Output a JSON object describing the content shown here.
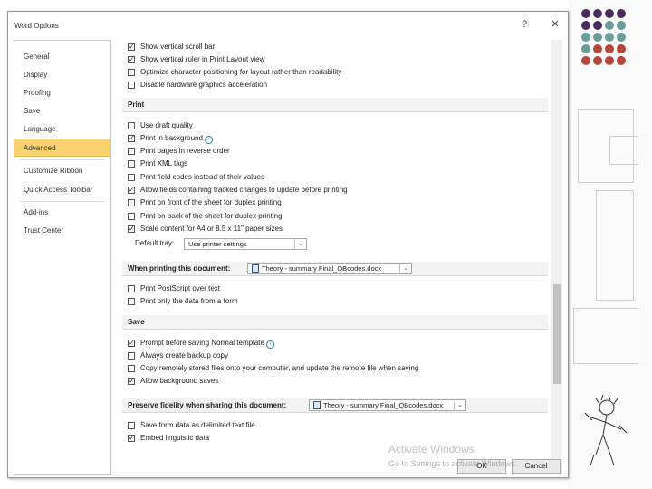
{
  "window": {
    "title": "Word Options",
    "help_label": "?",
    "close_label": "✕"
  },
  "nav": {
    "items": [
      {
        "label": "General"
      },
      {
        "label": "Display"
      },
      {
        "label": "Proofing"
      },
      {
        "label": "Save"
      },
      {
        "label": "Language"
      },
      {
        "label": "Advanced",
        "selected": true
      },
      {
        "label": "Customize Ribbon"
      },
      {
        "label": "Quick Access Toolbar"
      },
      {
        "label": "Add-ins"
      },
      {
        "label": "Trust Center"
      }
    ]
  },
  "display_options": [
    {
      "label": "Show vertical scroll bar",
      "checked": true
    },
    {
      "label": "Show vertical ruler in Print Layout view",
      "checked": true
    },
    {
      "label": "Optimize character positioning for layout rather than readability",
      "checked": false
    },
    {
      "label": "Disable hardware graphics acceleration",
      "checked": false
    }
  ],
  "print": {
    "header": "Print",
    "options": [
      {
        "label": "Use draft quality",
        "checked": false
      },
      {
        "label": "Print in background",
        "checked": true
      },
      {
        "label": "Print pages in reverse order",
        "checked": false
      },
      {
        "label": "Print XML tags",
        "checked": false
      },
      {
        "label": "Print field codes instead of their values",
        "checked": false
      },
      {
        "label": "Allow fields containing tracked changes to update before printing",
        "checked": true
      },
      {
        "label": "Print on front of the sheet for duplex printing",
        "checked": false
      },
      {
        "label": "Print on back of the sheet for duplex printing",
        "checked": false
      },
      {
        "label": "Scale content for A4 or 8.5 x 11\" paper sizes",
        "checked": true
      }
    ],
    "default_tray_label": "Default tray:",
    "default_tray_value": "Use printer settings"
  },
  "when_printing": {
    "header": "When printing this document:",
    "document": "Theory - summary Final_QBcodes.docx",
    "options": [
      {
        "label": "Print PostScript over text",
        "checked": false
      },
      {
        "label": "Print only the data from a form",
        "checked": false
      }
    ]
  },
  "save": {
    "header": "Save",
    "options": [
      {
        "label": "Prompt before saving Normal template",
        "checked": true
      },
      {
        "label": "Always create backup copy",
        "checked": false
      },
      {
        "label": "Copy remotely stored files onto your computer, and update the remote file when saving",
        "checked": false
      },
      {
        "label": "Allow background saves",
        "checked": true
      }
    ]
  },
  "preserve": {
    "header": "Preserve fidelity when sharing this document:",
    "document": "Theory - summary Final_QBcodes.docx",
    "options": [
      {
        "label": "Save form data as delimited text file",
        "checked": false
      },
      {
        "label": "Embed linguistic data",
        "checked": true
      }
    ]
  },
  "footer": {
    "ok_label": "OK",
    "cancel_label": "Cancel"
  },
  "watermark": {
    "line1": "Activate Windows",
    "line2": "Go to Settings to activate Windows."
  },
  "colors": {
    "nav_selected": "#f7d26f",
    "dot_purple": "#4b2a5e",
    "dot_teal": "#6a9c9a",
    "dot_red": "#b5473a"
  }
}
